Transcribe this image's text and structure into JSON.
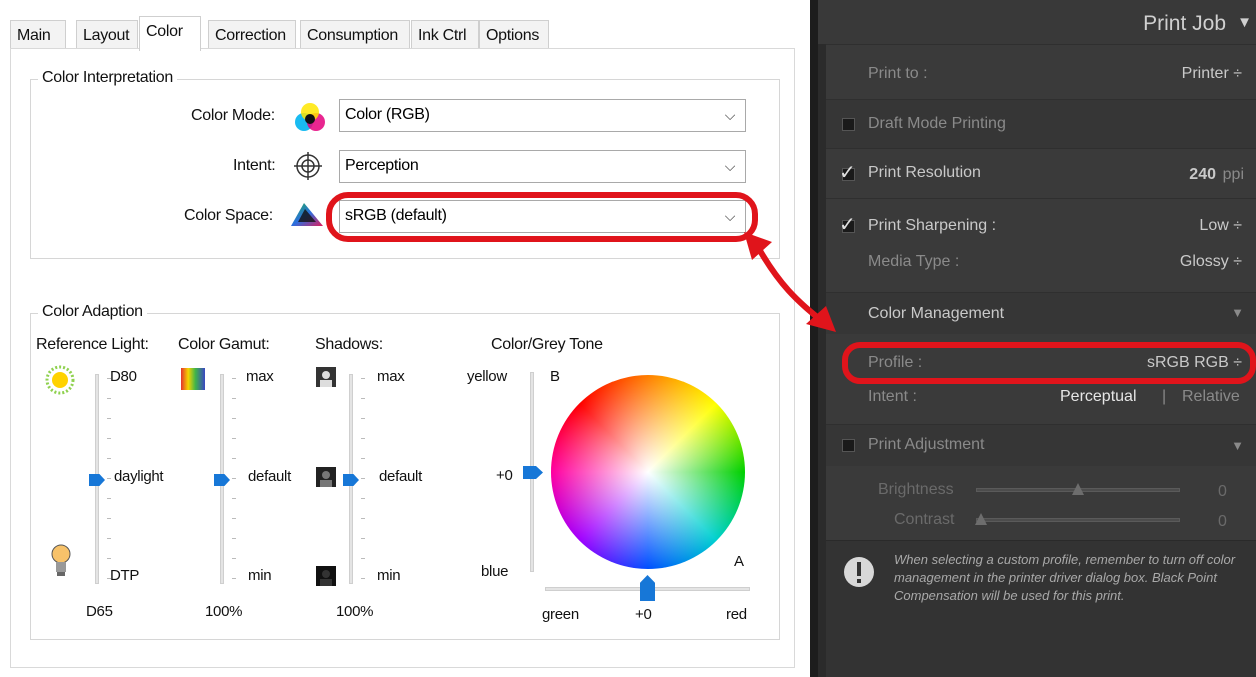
{
  "tabs": [
    "Main",
    "Layout",
    "Color",
    "Correction",
    "Consumption",
    "Ink Ctrl",
    "Options"
  ],
  "interp": {
    "group_label": "Color Interpretation",
    "color_mode_label": "Color Mode:",
    "color_mode_value": "Color (RGB)",
    "intent_label": "Intent:",
    "intent_value": "Perception",
    "color_space_label": "Color Space:",
    "color_space_value": "sRGB (default)"
  },
  "adapt": {
    "group_label": "Color Adaption",
    "ref_light": {
      "label": "Reference Light:",
      "top": "D80",
      "mid": "daylight",
      "bottom": "DTP",
      "value": "D65",
      "level": 0.5
    },
    "gamut": {
      "label": "Color Gamut:",
      "top": "max",
      "mid": "default",
      "bottom": "min",
      "value": "100%",
      "level": 0.5
    },
    "shadows": {
      "label": "Shadows:",
      "top": "max",
      "mid": "default",
      "bottom": "min",
      "value": "100%",
      "level": 0.5
    },
    "tone": {
      "label": "Color/Grey Tone",
      "yellow": "yellow",
      "b": "B",
      "plus0_v": "+0",
      "blue": "blue",
      "a": "A",
      "green": "green",
      "plus0_h": "+0",
      "red": "red"
    }
  },
  "right": {
    "title": "Print Job",
    "print_to_label": "Print to :",
    "print_to_value": "Printer ÷",
    "draft_label": "Draft Mode Printing",
    "res_label": "Print Resolution",
    "res_value": "240",
    "res_unit": "ppi",
    "sharp_label": "Print Sharpening :",
    "sharp_value": "Low ÷",
    "media_label": "Media Type :",
    "media_value": "Glossy ÷",
    "cm_label": "Color Management",
    "profile_label": "Profile :",
    "profile_value": "sRGB RGB ÷",
    "intent_label": "Intent :",
    "intent_perceptual": "Perceptual",
    "intent_sep": "|",
    "intent_relative": "Relative",
    "adj_label": "Print Adjustment",
    "brightness_label": "Brightness",
    "brightness_value": "0",
    "contrast_label": "Contrast",
    "contrast_value": "0",
    "note": "When selecting a custom profile, remember to turn off color management in the printer driver dialog box. Black Point Compensation will be used for this print."
  },
  "colors": {
    "accent": "#1777d7",
    "annotation": "#e0141b"
  }
}
